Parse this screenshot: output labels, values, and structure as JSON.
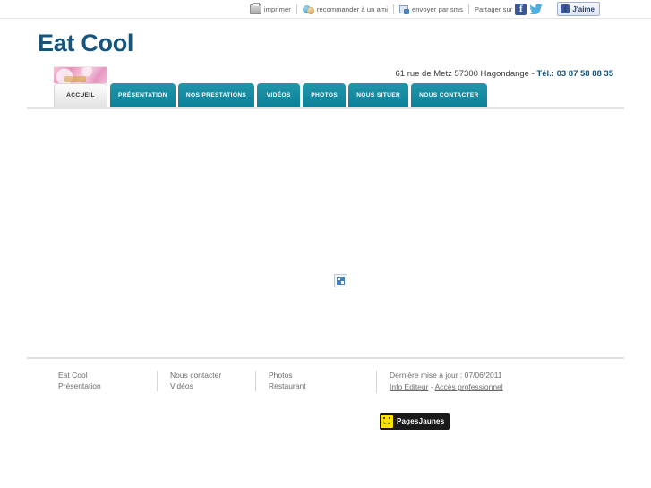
{
  "share_bar": {
    "items": [
      {
        "icon": "printer-icon",
        "label": "imprimer"
      },
      {
        "icon": "recommend-friend-icon",
        "label": "recommander à un ami"
      },
      {
        "icon": "send-sms-icon",
        "label": "envoyer par sms"
      }
    ],
    "share_label": "Partager sur",
    "facebook_glyph": "f",
    "facebook_like_label": "J'aime"
  },
  "header": {
    "site_title": "Eat Cool",
    "contact_address": "61 rue de Metz 57300 Hagondange",
    "contact_separator": "-",
    "contact_phone_label": "Tél.:",
    "contact_phone": "03 87 58 88 35"
  },
  "nav": {
    "tabs": [
      {
        "label": "ACCUEIL",
        "active": true
      },
      {
        "label": "PRÉSENTATION",
        "active": false
      },
      {
        "label": "NOS PRESTATIONS",
        "active": false
      },
      {
        "label": "VIDÉOS",
        "active": false
      },
      {
        "label": "PHOTOS",
        "active": false
      },
      {
        "label": "NOUS SITUER",
        "active": false
      },
      {
        "label": "NOUS CONTACTER",
        "active": false
      }
    ]
  },
  "main": {
    "broken_image_alt": ""
  },
  "footer": {
    "columns": [
      {
        "links": [
          "Eat Cool",
          "Présentation"
        ]
      },
      {
        "links": [
          "Nous contacter",
          "Vidéos"
        ]
      },
      {
        "links": [
          "Photos",
          "Restaurant"
        ]
      }
    ],
    "last_update": "Dernière mise à jour : 07/06/2011",
    "editor_link": "Info Éditeur",
    "links_separator": "-",
    "pro_access_link": "Accès professionnel",
    "pj_logo_text": "PagesJaunes"
  },
  "colors": {
    "tab_teal": "#0b7f96",
    "title_blue": "#14547f",
    "facebook_blue": "#3b5998",
    "pj_yellow": "#ffe000"
  }
}
